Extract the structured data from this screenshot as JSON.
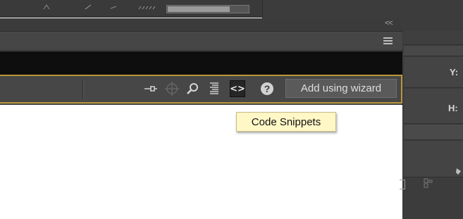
{
  "panel": {
    "collapse_glyph": "<<",
    "toolbar": {
      "code_snippets_glyph": "<>",
      "help_glyph": "?",
      "wizard_label": "Add using wizard"
    },
    "tooltip": "Code Snippets"
  },
  "inspector": {
    "y_label": "Y:",
    "h_label": "H:"
  },
  "colors": {
    "accent_border": "#b8963a",
    "tooltip_bg": "#fff7c6"
  }
}
